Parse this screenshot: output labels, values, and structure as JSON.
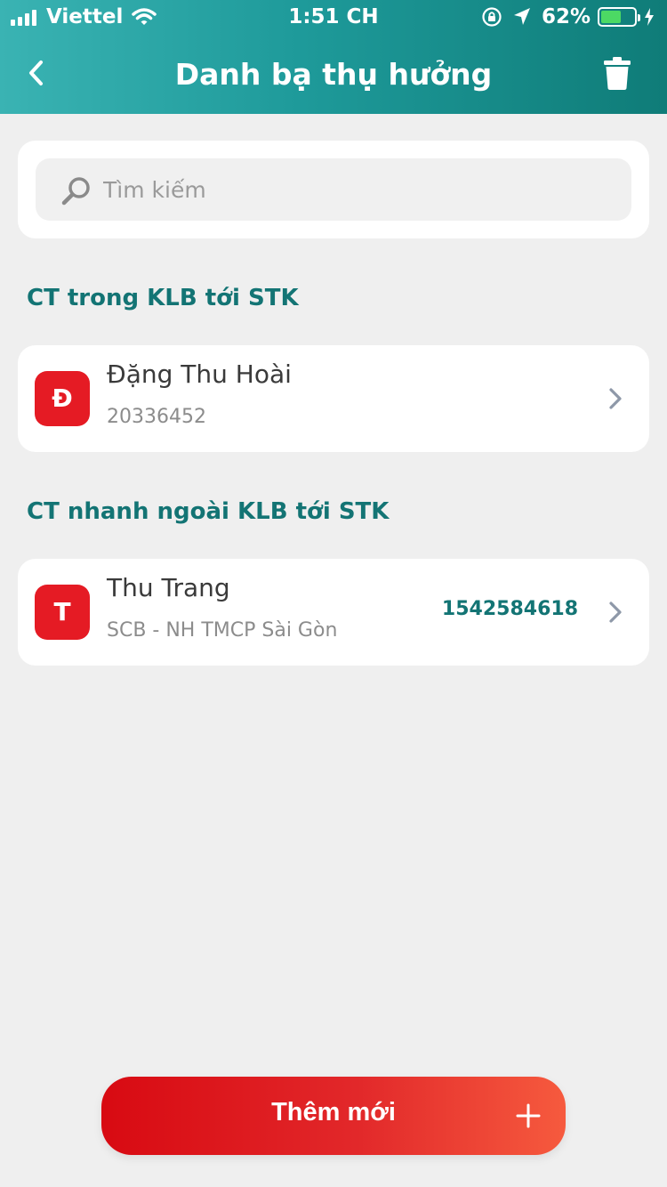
{
  "status_bar": {
    "carrier": "Viettel",
    "time": "1:51 CH",
    "battery_percent": "62%",
    "battery_level": 0.62
  },
  "header": {
    "title": "Danh bạ thụ hưởng",
    "icons": {
      "back": "chevron-left-icon",
      "delete": "trash-icon"
    }
  },
  "search": {
    "placeholder": "Tìm kiếm",
    "value": "",
    "icon": "search-icon"
  },
  "sections": [
    {
      "title": "CT trong KLB tới STK",
      "contacts": [
        {
          "initial": "Đ",
          "name": "Đặng Thu Hoài",
          "subtitle": "20336452",
          "account": ""
        }
      ]
    },
    {
      "title": "CT nhanh ngoài KLB tới STK",
      "contacts": [
        {
          "initial": "T",
          "name": "Thu Trang",
          "subtitle": "SCB - NH TMCP Sài Gòn",
          "account": "1542584618"
        }
      ]
    }
  ],
  "add_button": {
    "label": "Thêm mới",
    "icon": "plus-icon"
  },
  "colors": {
    "header_start": "#3ab3b3",
    "header_end": "#0f7c78",
    "accent_teal": "#137474",
    "avatar_red": "#e51b24",
    "button_start": "#d80a12",
    "button_end": "#f65a3e",
    "background": "#efefef"
  }
}
